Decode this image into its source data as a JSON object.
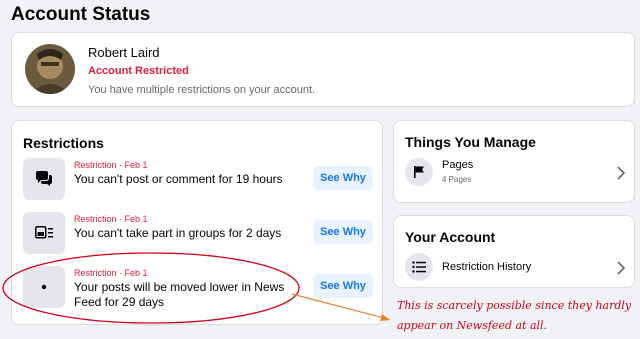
{
  "page_title": "Account Status",
  "account": {
    "name": "Robert Laird",
    "status": "Account Restricted",
    "status_color": "#e41e3f",
    "description": "You have multiple restrictions on your account."
  },
  "restrictions": {
    "title": "Restrictions",
    "meta_color": "#e41e3f",
    "items": [
      {
        "meta": "Restriction · Feb 1",
        "text": "You can't post or comment for 19 hours",
        "icon": "chat-bubbles-icon",
        "button": "See Why"
      },
      {
        "meta": "Restriction · Feb 1",
        "text": "You can't take part in groups for 2 days",
        "icon": "groups-icon",
        "button": "See Why"
      },
      {
        "meta": "Restriction · Feb 1",
        "text": "Your posts will be moved lower in News Feed for 29 days",
        "icon": "dot-icon",
        "button": "See Why"
      }
    ]
  },
  "things_you_manage": {
    "title": "Things You Manage",
    "pages_label": "Pages",
    "pages_count": "4 Pages"
  },
  "your_account": {
    "title": "Your Account",
    "history_label": "Restriction History"
  },
  "annotation": {
    "text": "This is scarcely possible since they hardly appear on Newsfeed at all.",
    "ellipse_color": "#d0021b",
    "arrow_color": "#e8822b"
  }
}
